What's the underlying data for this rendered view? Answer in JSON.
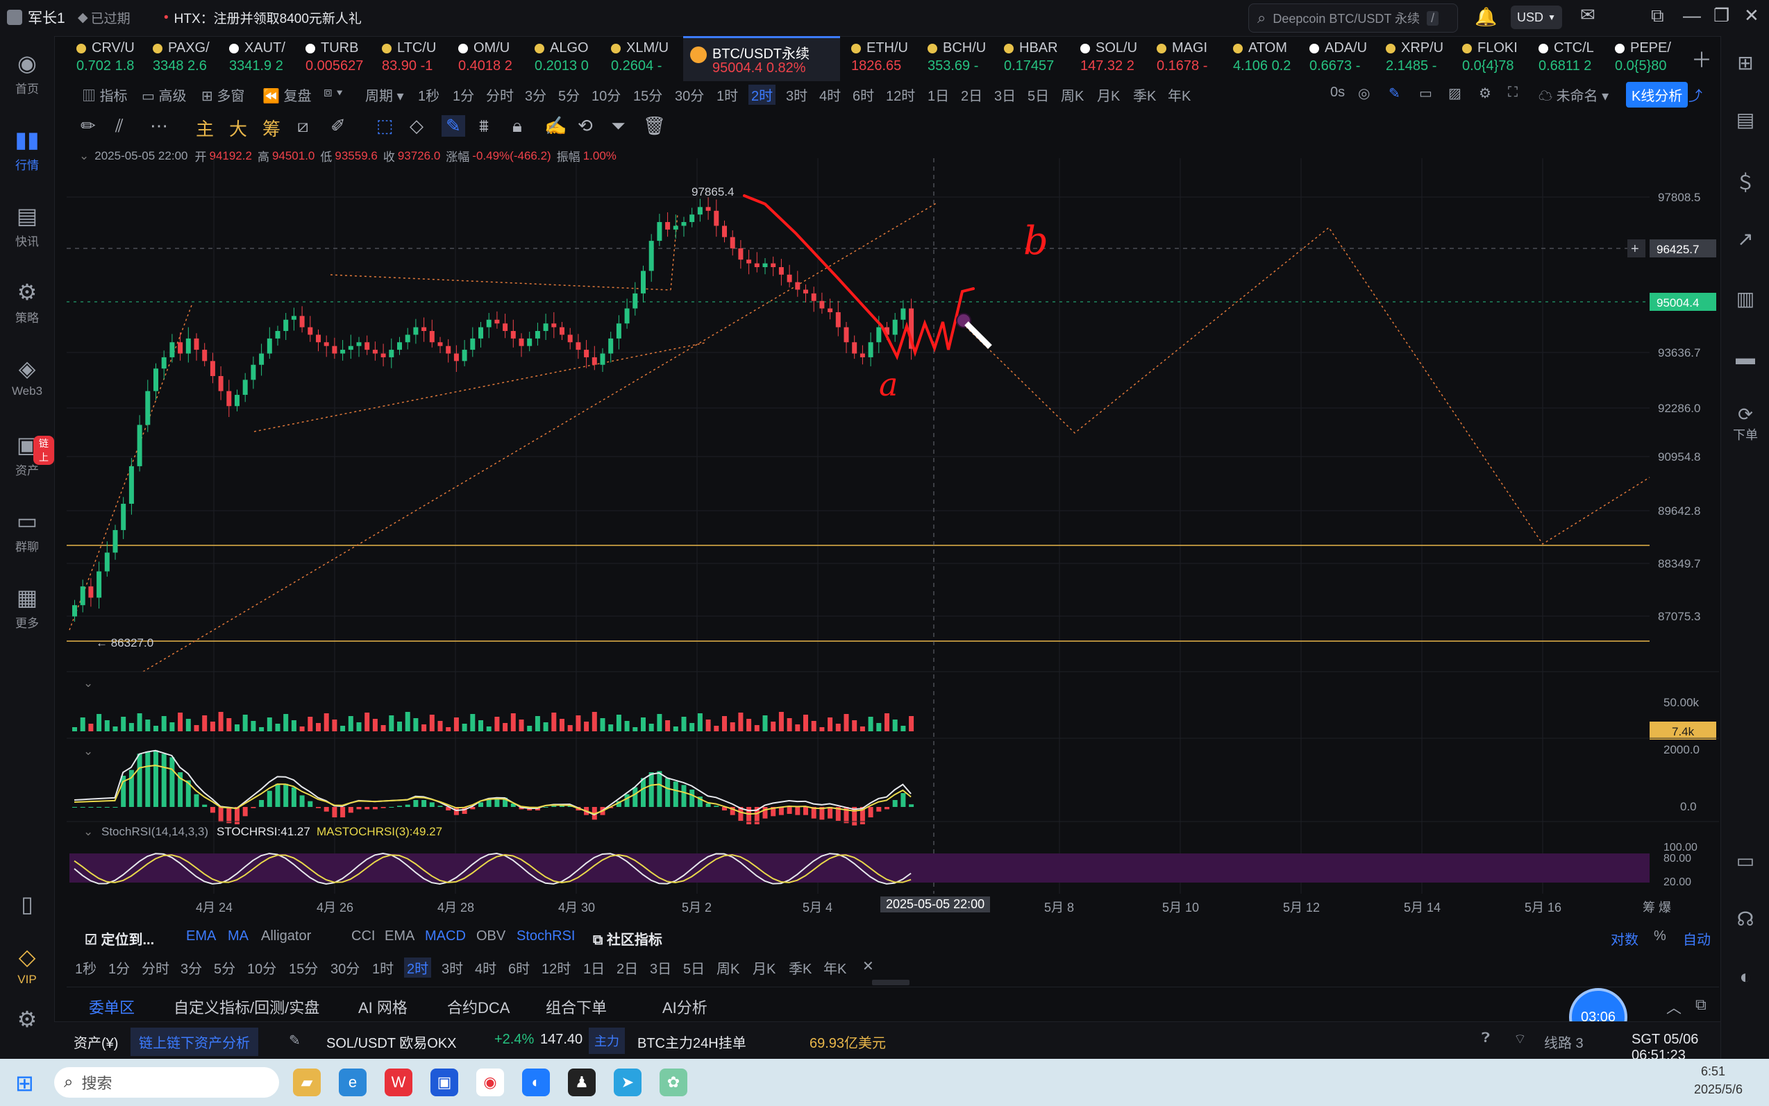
{
  "topbar": {
    "username": "军长1",
    "expired_label": "已过期",
    "ad_text": "HTX：注册并领取8400元新人礼",
    "search_placeholder": "Deepcoin BTC/USDT 永续",
    "currency": "USD"
  },
  "leftbar": [
    {
      "label": "首页",
      "icon": "home-icon"
    },
    {
      "label": "行情",
      "icon": "market-icon",
      "active": true
    },
    {
      "label": "快讯",
      "icon": "news-icon"
    },
    {
      "label": "策略",
      "icon": "strategy-icon"
    },
    {
      "label": "Web3",
      "icon": "web3-icon"
    },
    {
      "label": "资产",
      "icon": "assets-icon",
      "badge": "链上"
    },
    {
      "label": "群聊",
      "icon": "chat-icon"
    },
    {
      "label": "更多",
      "icon": "more-icon"
    },
    {
      "label": "VIP",
      "icon": "vip-icon"
    }
  ],
  "tickers": [
    {
      "name": "CRV/U",
      "price": "0.702 1.8",
      "dir": "up"
    },
    {
      "name": "PAXG/",
      "price": "3348 2.6",
      "dir": "up"
    },
    {
      "name": "XAUT/",
      "price": "3341.9 2",
      "dir": "up"
    },
    {
      "name": "TURB",
      "price": "0.005627",
      "dir": "down"
    },
    {
      "name": "LTC/U",
      "price": "83.90 -1",
      "dir": "down"
    },
    {
      "name": "OM/U",
      "price": "0.4018 2",
      "dir": "down"
    },
    {
      "name": "ALGO",
      "price": "0.2013 0",
      "dir": "up"
    },
    {
      "name": "XLM/U",
      "price": "0.2604 -",
      "dir": "up"
    },
    {
      "name": "BTC/USDT永续",
      "price": "95004.4 0.82%",
      "dir": "down",
      "active": true
    },
    {
      "name": "ETH/U",
      "price": "1826.65",
      "dir": "down"
    },
    {
      "name": "BCH/U",
      "price": "353.69 -",
      "dir": "up"
    },
    {
      "name": "HBAR",
      "price": "0.17457",
      "dir": "up"
    },
    {
      "name": "SOL/U",
      "price": "147.32 2",
      "dir": "down"
    },
    {
      "name": "MAGI",
      "price": "0.1678 -",
      "dir": "down"
    },
    {
      "name": "ATOM",
      "price": "4.106 0.2",
      "dir": "up"
    },
    {
      "name": "ADA/U",
      "price": "0.6673 -",
      "dir": "up"
    },
    {
      "name": "XRP/U",
      "price": "2.1485 -",
      "dir": "up"
    },
    {
      "name": "FLOKI",
      "price": "0.0{4}78",
      "dir": "up"
    },
    {
      "name": "CTC/L",
      "price": "0.6811 2",
      "dir": "up"
    },
    {
      "name": "PEPE/",
      "price": "0.0{5}80",
      "dir": "up"
    }
  ],
  "interval_toolbar": {
    "items": [
      "指标",
      "高级",
      "多窗",
      "复盘",
      "周期",
      "1秒",
      "1分",
      "分时",
      "3分",
      "5分",
      "10分",
      "15分",
      "30分",
      "1时",
      "2时",
      "3时",
      "4时",
      "6时",
      "12时",
      "1日",
      "2日",
      "3日",
      "5日",
      "周K",
      "月K",
      "季K",
      "年K"
    ],
    "selected": "2时",
    "right_items": [
      "0s",
      "未命名",
      "K线分析"
    ]
  },
  "drawing_toolbar": {
    "items": [
      "主",
      "大",
      "筹"
    ]
  },
  "ohlc": {
    "date": "2025-05-05 22:00",
    "open_label": "开",
    "open": "94192.2",
    "high_label": "高",
    "high": "94501.0",
    "low_label": "低",
    "low": "93559.6",
    "close_label": "收",
    "close": "93726.0",
    "change_label": "涨幅",
    "change": "-0.49%(-466.2)",
    "amplitude_label": "振幅",
    "amplitude": "1.00%"
  },
  "chart_data": {
    "type": "candlestick",
    "price_axis": [
      "97808.5",
      "93636.7",
      "92286.0",
      "90954.8",
      "89642.8",
      "88349.7",
      "87075.3"
    ],
    "price_labels": {
      "crosshair": "96425.7",
      "current": "95004.4"
    },
    "annotations": {
      "high": "97865.4",
      "low": "← 86327.0",
      "hand_a": "a",
      "hand_b": "b"
    },
    "x_axis": [
      "4月 24",
      "4月 26",
      "4月 28",
      "4月 30",
      "5月 2",
      "5月 4",
      "2025-05-05 22:00",
      "5月 8",
      "5月 10",
      "5月 12",
      "5月 14",
      "5月 16"
    ],
    "x_axis_right": "筹 爆",
    "ylim": [
      85500,
      98800
    ],
    "closes": [
      86900,
      87400,
      87100,
      87800,
      88300,
      88900,
      89600,
      90600,
      91700,
      92600,
      93200,
      93500,
      93900,
      93600,
      94000,
      93700,
      93400,
      93000,
      92600,
      92200,
      92500,
      92900,
      93300,
      93600,
      94000,
      94200,
      94500,
      94600,
      94300,
      94100,
      93900,
      93800,
      93600,
      93700,
      93800,
      93900,
      93700,
      93600,
      93500,
      93700,
      93900,
      94100,
      94300,
      94200,
      93900,
      93800,
      93600,
      93400,
      93700,
      94000,
      94300,
      94500,
      94400,
      94200,
      94000,
      93800,
      94000,
      94200,
      94400,
      94300,
      94100,
      93900,
      93700,
      93500,
      93300,
      93600,
      94000,
      94400,
      94800,
      95200,
      95800,
      96600,
      97100,
      96900,
      97000,
      97100,
      97300,
      97500,
      97400,
      97000,
      96700,
      96400,
      96100,
      96000,
      95900,
      96000,
      95900,
      95700,
      95500,
      95300,
      95200,
      95000,
      94800,
      94700,
      94300,
      93900,
      93600,
      93500,
      93900,
      94300,
      94100,
      94500,
      94800,
      93726
    ],
    "volume_label": "50.00k",
    "volume_current": "7.4k",
    "macd_axis": [
      "2000.0",
      "0.0"
    ],
    "stochrsi": {
      "label": "StochRSI(14,14,3,3)",
      "value_label": "STOCHRSI:41.27",
      "ma_label": "MASTOCHRSI(3):49.27",
      "axis": [
        "100.00",
        "80.00",
        "20.00"
      ]
    }
  },
  "indicator_bar": {
    "locate": "定位到...",
    "items": [
      "EMA",
      "MA",
      "Alligator",
      "CCI",
      "EMA",
      "MACD",
      "OBV",
      "StochRSI",
      "社区指标"
    ],
    "right": [
      "对数",
      "%",
      "自动"
    ]
  },
  "interval_bar2": [
    "1秒",
    "1分",
    "分时",
    "3分",
    "5分",
    "10分",
    "15分",
    "30分",
    "1时",
    "2时",
    "3时",
    "4时",
    "6时",
    "12时",
    "1日",
    "2日",
    "3日",
    "5日",
    "周K",
    "月K",
    "季K",
    "年K"
  ],
  "bottom_tabs": [
    "委单区",
    "自定义指标/回测/实盘",
    "AI 网格",
    "合约DCA",
    "组合下单",
    "AI分析"
  ],
  "timer": "03:06",
  "status": {
    "assets": "资产(¥)",
    "chain_btn": "链上链下资产分析",
    "sol": "SOL/USDT 欧易OKX",
    "sol_change": "+2.4%",
    "sol_price": "147.40",
    "main_tag": "主力",
    "btc_order": "BTC主力24H挂单",
    "btc_order_val": "69.93亿美元",
    "line": "线路 3",
    "clock": "SGT 05/06 06:51:23"
  },
  "taskbar": {
    "search": "搜索",
    "time": "6:51",
    "date": "2025/5/6"
  }
}
